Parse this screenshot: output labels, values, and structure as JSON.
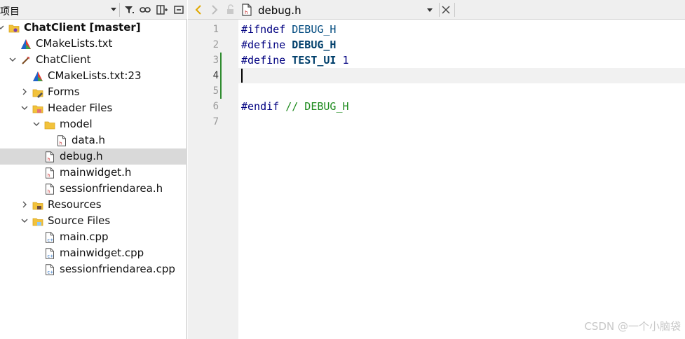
{
  "left_panel": {
    "title": "项目",
    "tree": [
      {
        "label": "ChatClient [master]",
        "indent": 0,
        "expanded": true,
        "bold": true,
        "icon": "project-icon"
      },
      {
        "label": "CMakeLists.txt",
        "indent": 1,
        "icon": "cmake-icon"
      },
      {
        "label": "ChatClient",
        "indent": 1,
        "expanded": true,
        "icon": "target-icon"
      },
      {
        "label": "CMakeLists.txt:23",
        "indent": 2,
        "icon": "cmake-icon"
      },
      {
        "label": "Forms",
        "indent": 2,
        "expanded": false,
        "icon": "forms-folder-icon"
      },
      {
        "label": "Header Files",
        "indent": 2,
        "expanded": true,
        "icon": "header-folder-icon"
      },
      {
        "label": "model",
        "indent": 3,
        "expanded": true,
        "icon": "folder-icon"
      },
      {
        "label": "data.h",
        "indent": 4,
        "icon": "header-file-icon"
      },
      {
        "label": "debug.h",
        "indent": 3,
        "selected": true,
        "icon": "header-file-icon"
      },
      {
        "label": "mainwidget.h",
        "indent": 3,
        "icon": "header-file-icon"
      },
      {
        "label": "sessionfriendarea.h",
        "indent": 3,
        "icon": "header-file-icon"
      },
      {
        "label": "Resources",
        "indent": 2,
        "expanded": false,
        "icon": "resources-folder-icon"
      },
      {
        "label": "Source Files",
        "indent": 2,
        "expanded": true,
        "icon": "source-folder-icon"
      },
      {
        "label": "main.cpp",
        "indent": 3,
        "icon": "cpp-file-icon"
      },
      {
        "label": "mainwidget.cpp",
        "indent": 3,
        "icon": "cpp-file-icon"
      },
      {
        "label": "sessionfriendarea.cpp",
        "indent": 3,
        "icon": "cpp-file-icon"
      }
    ]
  },
  "editor": {
    "file_name": "debug.h",
    "current_line": 4,
    "line_numbers": [
      "1",
      "2",
      "3",
      "4",
      "5",
      "6",
      "7"
    ],
    "lines": [
      {
        "parts": [
          {
            "t": "#ifndef ",
            "c": "kw-pre"
          },
          {
            "t": "DEBUG_H",
            "c": "kw-macro"
          }
        ]
      },
      {
        "parts": [
          {
            "t": "#define ",
            "c": "kw-pre"
          },
          {
            "t": "DEBUG_H",
            "c": "kw-macro-bold"
          }
        ]
      },
      {
        "parts": [
          {
            "t": "#define ",
            "c": "kw-pre"
          },
          {
            "t": "TEST_UI",
            "c": "kw-macro-bold"
          },
          {
            "t": " 1",
            "c": "num"
          }
        ]
      },
      {
        "parts": []
      },
      {
        "parts": []
      },
      {
        "parts": [
          {
            "t": "#endif ",
            "c": "kw-pre"
          },
          {
            "t": "// DEBUG_H",
            "c": "cmt"
          }
        ]
      },
      {
        "parts": []
      }
    ]
  },
  "watermark": "CSDN @一个小脑袋",
  "colors": {
    "change_bar": "#2e8b2e",
    "selection": "#d9d9d9",
    "gutter": "#f0f0f0"
  }
}
